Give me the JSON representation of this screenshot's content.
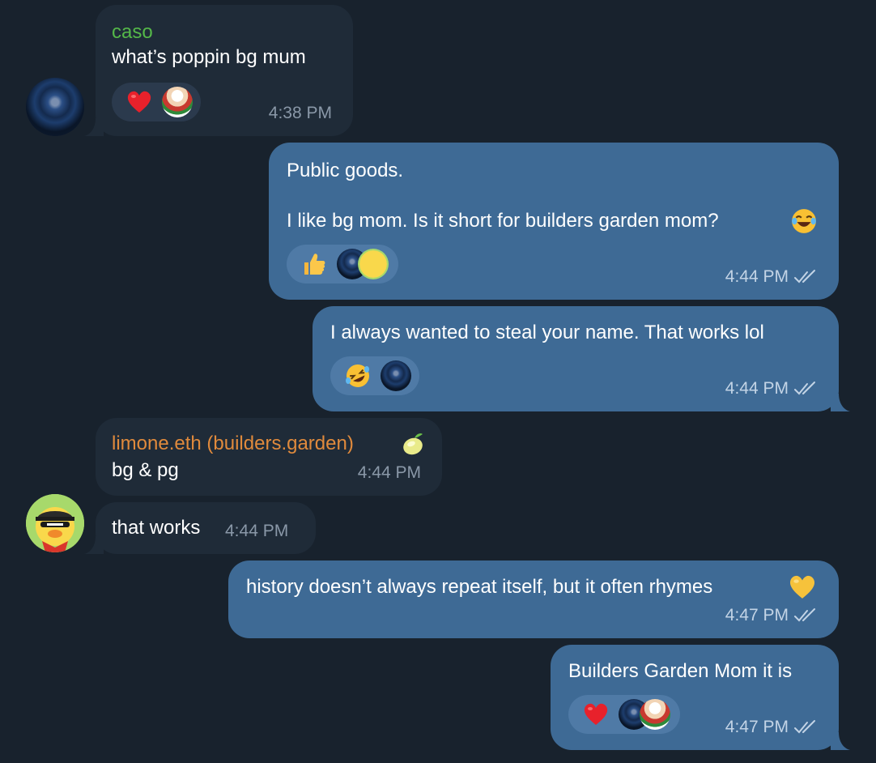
{
  "colors": {
    "background": "#18222d",
    "incoming_bubble": "#1f2b38",
    "outgoing_bubble": "#3e6a95",
    "caso_name": "#55b849",
    "limone_name": "#e08a3c",
    "read_ticks": "#c3d4e6"
  },
  "messages": [
    {
      "direction": "incoming",
      "sender": "caso",
      "text": "what’s poppin bg mum",
      "time": "4:38 PM",
      "reactions": {
        "emoji": "red-heart",
        "avatars": [
          "chef-avatar"
        ]
      },
      "avatar": "robot-avatar"
    },
    {
      "direction": "outgoing",
      "line1": "Public goods.",
      "line2": "I like bg mom. Is it short for builders garden mom?",
      "emoji": "laughing-face",
      "time": "4:44 PM",
      "status": "read",
      "reactions": {
        "emoji": "thumbs-up",
        "avatars": [
          "robot-avatar",
          "duck-avatar"
        ]
      }
    },
    {
      "direction": "outgoing",
      "text": "I always wanted to steal your name. That works lol",
      "time": "4:44 PM",
      "status": "read",
      "reactions": {
        "emoji": "rolling-laughing-face",
        "avatars": [
          "robot-avatar"
        ]
      }
    },
    {
      "direction": "incoming",
      "sender": "limone.eth (builders.garden)",
      "sender_emoji": "lemon",
      "text": "bg & pg",
      "time": "4:44 PM"
    },
    {
      "direction": "incoming",
      "text": "that works",
      "time": "4:44 PM",
      "avatar": "duck-avatar"
    },
    {
      "direction": "outgoing",
      "text": "history doesn’t always repeat itself, but it often rhymes",
      "emoji": "yellow-heart",
      "time": "4:47 PM",
      "status": "read"
    },
    {
      "direction": "outgoing",
      "text": "Builders Garden Mom it is",
      "time": "4:47 PM",
      "status": "read",
      "reactions": {
        "emoji": "red-heart",
        "avatars": [
          "robot-avatar",
          "chef-avatar"
        ]
      }
    }
  ]
}
